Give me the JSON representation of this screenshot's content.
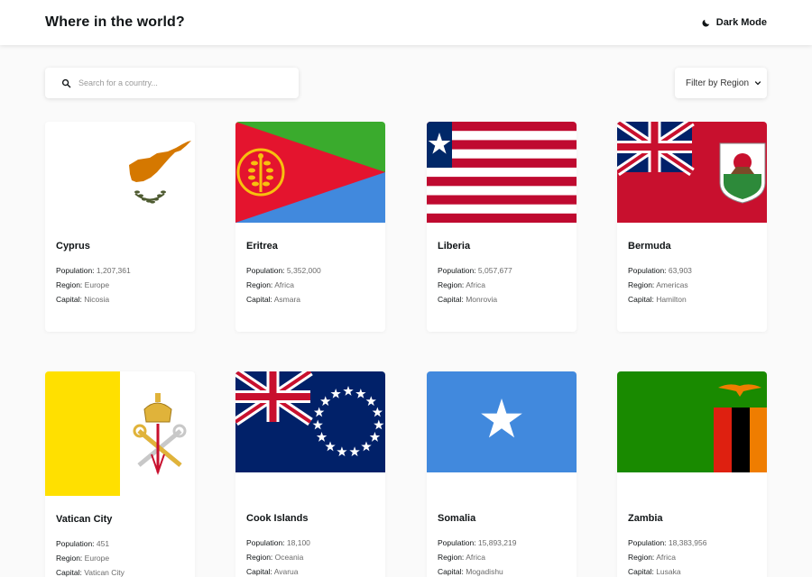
{
  "app": {
    "title": "Where in the world?",
    "theme_toggle_label": "Dark Mode"
  },
  "search": {
    "placeholder": "Search for a country..."
  },
  "filter": {
    "label": "Filter by Region"
  },
  "labels": {
    "population": "Population: ",
    "region": "Region: ",
    "capital": "Capital: "
  },
  "countries": [
    {
      "name": "Cyprus",
      "population": "1,207,361",
      "region": "Europe",
      "capital": "Nicosia"
    },
    {
      "name": "Eritrea",
      "population": "5,352,000",
      "region": "Africa",
      "capital": "Asmara"
    },
    {
      "name": "Liberia",
      "population": "5,057,677",
      "region": "Africa",
      "capital": "Monrovia"
    },
    {
      "name": "Bermuda",
      "population": "63,903",
      "region": "Americas",
      "capital": "Hamilton"
    },
    {
      "name": "Vatican City",
      "population": "451",
      "region": "Europe",
      "capital": "Vatican City"
    },
    {
      "name": "Cook Islands",
      "population": "18,100",
      "region": "Oceania",
      "capital": "Avarua"
    },
    {
      "name": "Somalia",
      "population": "15,893,219",
      "region": "Africa",
      "capital": "Mogadishu"
    },
    {
      "name": "Zambia",
      "population": "18,383,956",
      "region": "Africa",
      "capital": "Lusaka"
    }
  ],
  "colors": {
    "background": "#fafafa",
    "card": "#ffffff",
    "text": "#111517",
    "muted": "#6b6b6b"
  }
}
